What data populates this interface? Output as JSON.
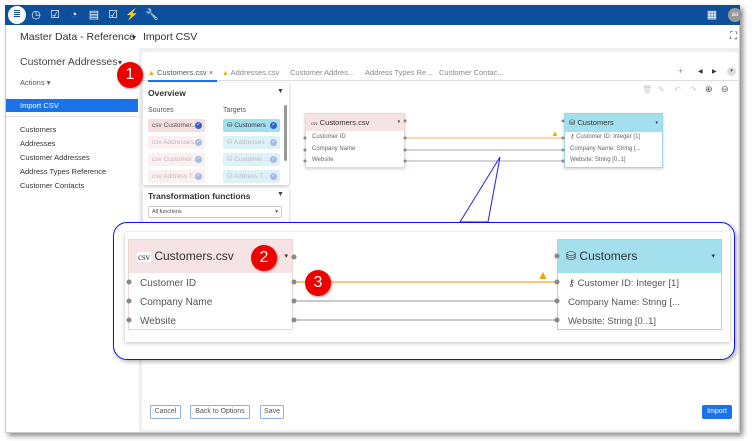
{
  "topbar": {
    "icons": [
      "database-icon",
      "clock-icon",
      "checkbox-icon",
      "gauge-icon",
      "document-list-icon",
      "checklist-icon",
      "plug-icon",
      "wrench-icon"
    ],
    "right_icons": [
      "report-icon"
    ],
    "avatar": "aa"
  },
  "breadcrumb": {
    "app": "Master Data - Reference",
    "page": "Import CSV"
  },
  "sidebar": {
    "title": "Customer Addresses",
    "actions": "Actions",
    "selected": "Import CSV",
    "items": [
      "Customers",
      "Addresses",
      "Customer Addresses",
      "Address Types Reference",
      "Customer Contacts"
    ]
  },
  "tabs": [
    {
      "label": "Customers.csv",
      "warning": true,
      "active": true
    },
    {
      "label": "Addresses.csv",
      "warning": true
    },
    {
      "label": "Customer Addres..."
    },
    {
      "label": "Address Types Re..."
    },
    {
      "label": "Customer Contac..."
    }
  ],
  "overview": {
    "title": "Overview",
    "sources_label": "Sources",
    "targets_label": "Targets",
    "sources": [
      "Customer...",
      "Addresses...",
      "Customer ...",
      "Address T..."
    ],
    "targets": [
      "Customers",
      "Addresses",
      "Customer ...",
      "Address T..."
    ]
  },
  "transform": {
    "title": "Transformation functions",
    "select_value": "All functions"
  },
  "source_node": {
    "icon": "csv",
    "title": "Customers.csv",
    "fields": [
      "Customer ID",
      "Company Name",
      "Website"
    ]
  },
  "target_node": {
    "title": "Customers",
    "fields": [
      "Customer ID: Integer [1]",
      "Company Name: String [...",
      "Website: String [0..1]"
    ]
  },
  "badges": [
    "1",
    "2",
    "3"
  ],
  "buttons": {
    "cancel": "Cancel",
    "back": "Back to Options",
    "save": "Save",
    "import": "Import"
  },
  "colors": {
    "topbar": "#0e4f9c",
    "accent": "#1a73e8",
    "source": "#f6e3e3",
    "target": "#a3dfec",
    "mapping_warning": "#f5a623",
    "callout": "#0000ee",
    "badge": "#e00000"
  }
}
